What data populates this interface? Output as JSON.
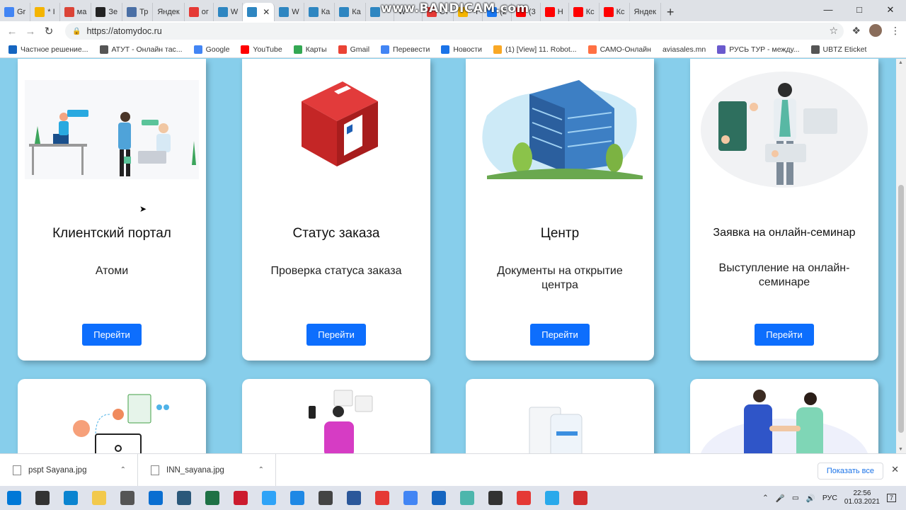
{
  "browser": {
    "tabs": [
      {
        "label": "Gr",
        "icon": "google-icon",
        "color": "#4285F4"
      },
      {
        "label": "* I",
        "icon": "mail-icon",
        "color": "#F4B400"
      },
      {
        "label": "ма",
        "icon": "doc-icon",
        "color": "#DB4437"
      },
      {
        "label": "Зе",
        "icon": "n-icon",
        "color": "#222222"
      },
      {
        "label": "Тр",
        "icon": "translate-icon",
        "color": "#4A6FA5"
      },
      {
        "label": "Яндек",
        "icon": "",
        "color": ""
      },
      {
        "label": "ог",
        "icon": "yandex-icon",
        "color": "#E53935"
      },
      {
        "label": "W",
        "icon": "atomy-icon",
        "color": "#2E86C1"
      },
      {
        "label": "",
        "icon": "atomy-icon",
        "color": "#2E86C1",
        "active": true
      },
      {
        "label": "W",
        "icon": "atomy-icon",
        "color": "#2E86C1"
      },
      {
        "label": "Ка",
        "icon": "atomy-icon",
        "color": "#2E86C1"
      },
      {
        "label": "Ка",
        "icon": "atomy-icon",
        "color": "#2E86C1"
      },
      {
        "label": "",
        "icon": "atomy-icon",
        "color": "#2E86C1"
      },
      {
        "label": "W",
        "icon": "",
        "color": ""
      },
      {
        "label": "Ст",
        "icon": "yandex-icon",
        "color": "#E53935"
      },
      {
        "label": "* I",
        "icon": "mail-icon",
        "color": "#F4B400"
      },
      {
        "label": "(2",
        "icon": "facebook-icon",
        "color": "#1877F2"
      },
      {
        "label": "(3",
        "icon": "youtube-icon",
        "color": "#FF0000"
      },
      {
        "label": "Н",
        "icon": "youtube-icon",
        "color": "#FF0000"
      },
      {
        "label": "Кс",
        "icon": "youtube-icon",
        "color": "#FF0000"
      },
      {
        "label": "Кс",
        "icon": "youtube-icon",
        "color": "#FF0000"
      },
      {
        "label": "Яндек",
        "icon": "",
        "color": ""
      }
    ],
    "watermark": "www.BANDICAM.com",
    "url": "https://atomydoc.ru",
    "bookmarks": [
      {
        "label": "Частное решение...",
        "color": "#1565C0"
      },
      {
        "label": "АТУТ - Онлайн тас...",
        "color": "#555555"
      },
      {
        "label": "Google",
        "color": "#4285F4"
      },
      {
        "label": "YouTube",
        "color": "#FF0000"
      },
      {
        "label": "Карты",
        "color": "#34A853"
      },
      {
        "label": "Gmail",
        "color": "#EA4335"
      },
      {
        "label": "Перевести",
        "color": "#4285F4"
      },
      {
        "label": "Новости",
        "color": "#1A73E8"
      },
      {
        "label": "(1) [View] 11. Robot...",
        "color": "#F9A825"
      },
      {
        "label": "САМО-Онлайн",
        "color": "#FF7043"
      },
      {
        "label": "aviasales.mn",
        "color": ""
      },
      {
        "label": "РУСЬ ТУР - между...",
        "color": "#6A5ACD"
      },
      {
        "label": "UBTZ Eticket",
        "color": "#555555"
      }
    ]
  },
  "cards": [
    {
      "title": "Клиентский портал",
      "subtitle": "Атоми",
      "button": "Перейти",
      "illustration": "office-team-illustration"
    },
    {
      "title": "Статус заказа",
      "subtitle": "Проверка статуса заказа",
      "button": "Перейти",
      "illustration": "parcel-box-illustration"
    },
    {
      "title": "Центр",
      "subtitle": "Документы на открытие центра",
      "button": "Перейти",
      "illustration": "office-building-illustration"
    },
    {
      "title": "Заявка на онлайн-семинар",
      "subtitle": "Выступление на онлайн-семинаре",
      "button": "Перейти",
      "illustration": "online-seminar-illustration"
    }
  ],
  "cards_row2": [
    {
      "illustration": "document-sharing-illustration"
    },
    {
      "illustration": "mobile-user-illustration"
    },
    {
      "illustration": "documents-phone-illustration"
    },
    {
      "illustration": "handshake-illustration"
    }
  ],
  "downloads": [
    {
      "file": "pspt Sayana.jpg"
    },
    {
      "file": "INN_sayana.jpg"
    }
  ],
  "downloads_show_all": "Показать все",
  "taskbar": {
    "lang": "РУС",
    "time": "22:56",
    "date": "01.03.2021",
    "notifications": "7",
    "apps": [
      {
        "icon": "start-icon",
        "color": "#0078D7"
      },
      {
        "icon": "search-icon",
        "color": "#333333"
      },
      {
        "icon": "edge-icon",
        "color": "#0A84D0"
      },
      {
        "icon": "explorer-icon",
        "color": "#F2C94C"
      },
      {
        "icon": "store-icon",
        "color": "#555555"
      },
      {
        "icon": "mail-app-icon",
        "color": "#0A6ED1"
      },
      {
        "icon": "vk-icon",
        "color": "#2B587A"
      },
      {
        "icon": "excel-icon",
        "color": "#1E7145"
      },
      {
        "icon": "opera-icon",
        "color": "#CC1B2E"
      },
      {
        "icon": "photoshop-icon",
        "color": "#2FA3F7"
      },
      {
        "icon": "photos-icon",
        "color": "#1E88E5"
      },
      {
        "icon": "calculator-icon",
        "color": "#444444"
      },
      {
        "icon": "word-icon",
        "color": "#2B579A"
      },
      {
        "icon": "yandex-browser-icon",
        "color": "#E53935"
      },
      {
        "icon": "chrome-icon",
        "color": "#4285F4"
      },
      {
        "icon": "remote-desktop-icon",
        "color": "#1565C0"
      },
      {
        "icon": "notes-icon",
        "color": "#4DB6AC"
      },
      {
        "icon": "settings-icon",
        "color": "#333333"
      },
      {
        "icon": "yandex-icon",
        "color": "#E53935"
      },
      {
        "icon": "telegram-icon",
        "color": "#29A9EB"
      },
      {
        "icon": "record-icon",
        "color": "#D32F2F"
      }
    ]
  }
}
